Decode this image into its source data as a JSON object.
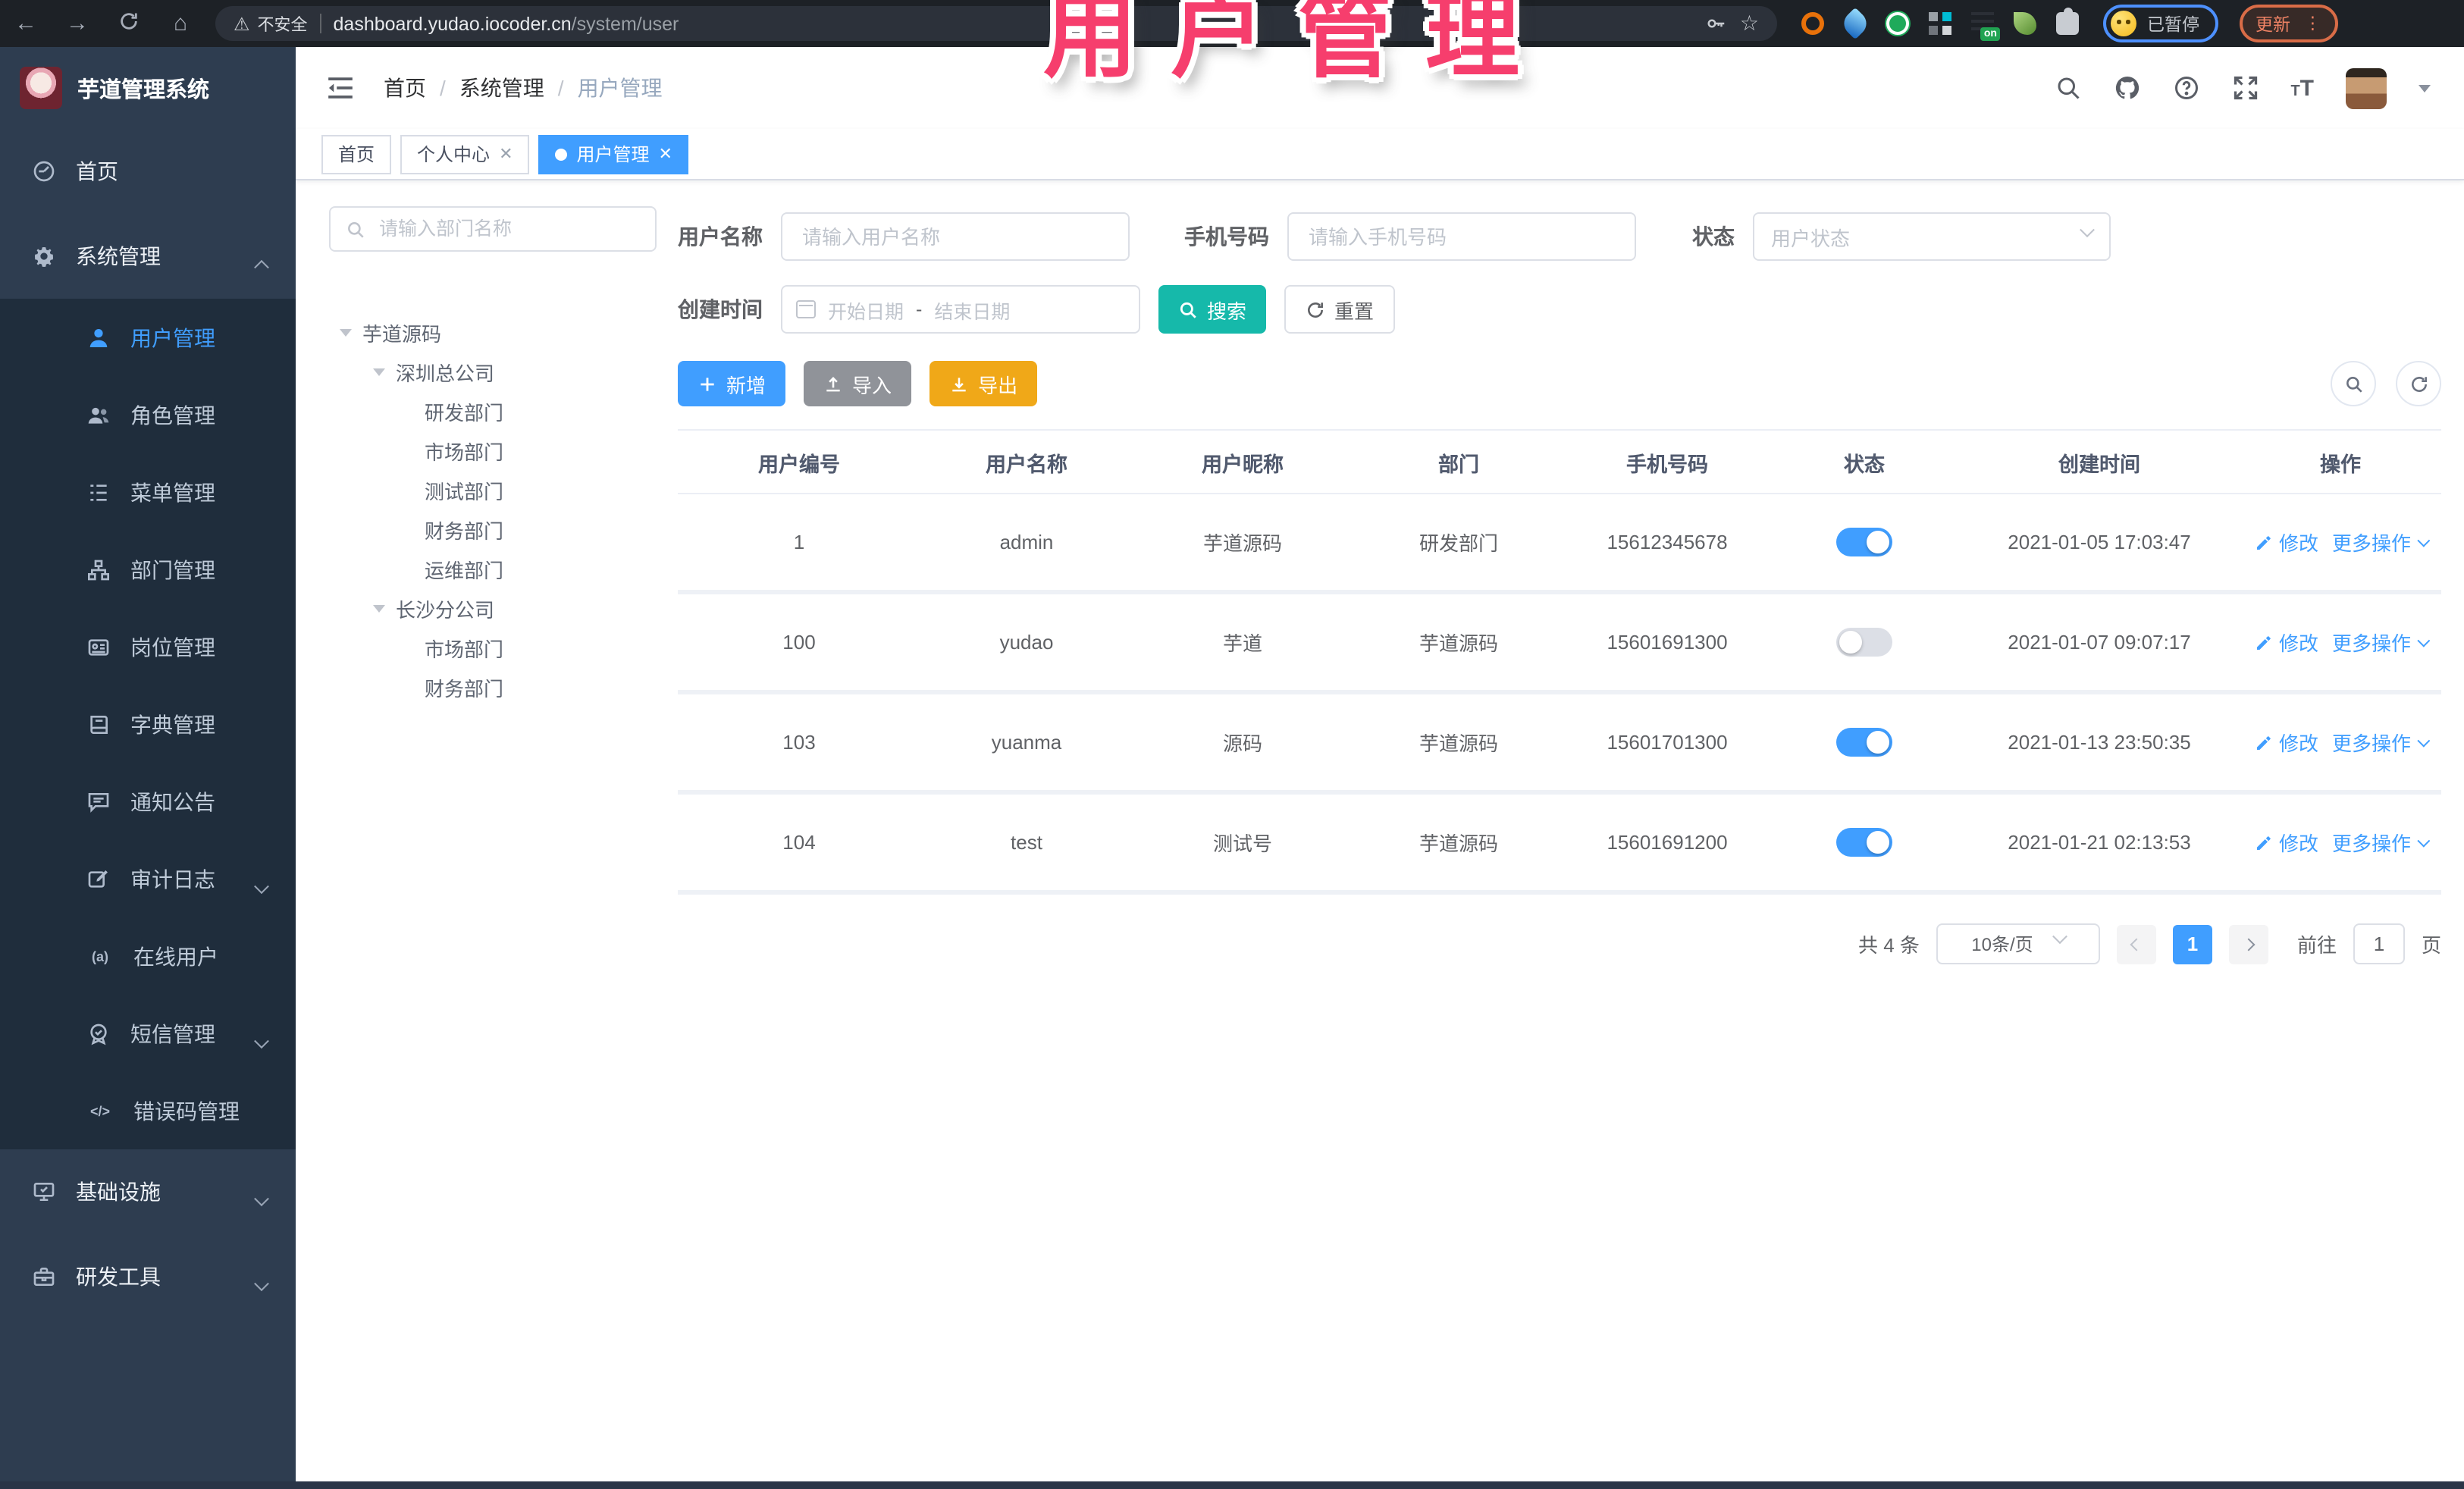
{
  "overlay_title": "用户管理",
  "browser": {
    "security_label": "不安全",
    "url_domain": "dashboard.yudao.iocoder.cn",
    "url_path": "/system/user",
    "extension_on_badge": "on",
    "paused_badge": "已暂停",
    "update_label": "更新"
  },
  "sidebar": {
    "app_title": "芋道管理系统",
    "items": [
      {
        "label": "首页"
      },
      {
        "label": "系统管理"
      },
      {
        "label": "用户管理"
      },
      {
        "label": "角色管理"
      },
      {
        "label": "菜单管理"
      },
      {
        "label": "部门管理"
      },
      {
        "label": "岗位管理"
      },
      {
        "label": "字典管理"
      },
      {
        "label": "通知公告"
      },
      {
        "label": "审计日志"
      },
      {
        "label": "在线用户"
      },
      {
        "label": "短信管理"
      },
      {
        "label": "错误码管理"
      },
      {
        "label": "基础设施"
      },
      {
        "label": "研发工具"
      }
    ]
  },
  "breadcrumb": {
    "items": [
      "首页",
      "系统管理",
      "用户管理"
    ],
    "sep": "/"
  },
  "tabs": [
    {
      "label": "首页"
    },
    {
      "label": "个人中心"
    },
    {
      "label": "用户管理"
    }
  ],
  "tree": {
    "search_placeholder": "请输入部门名称",
    "nodes": [
      {
        "label": "芋道源码"
      },
      {
        "label": "深圳总公司"
      },
      {
        "label": "研发部门"
      },
      {
        "label": "市场部门"
      },
      {
        "label": "测试部门"
      },
      {
        "label": "财务部门"
      },
      {
        "label": "运维部门"
      },
      {
        "label": "长沙分公司"
      },
      {
        "label": "市场部门"
      },
      {
        "label": "财务部门"
      }
    ]
  },
  "filters": {
    "username_label": "用户名称",
    "username_placeholder": "请输入用户名称",
    "mobile_label": "手机号码",
    "mobile_placeholder": "请输入手机号码",
    "status_label": "状态",
    "status_placeholder": "用户状态",
    "create_time_label": "创建时间",
    "date_start_placeholder": "开始日期",
    "date_separator": "-",
    "date_end_placeholder": "结束日期",
    "search_label": "搜索",
    "reset_label": "重置"
  },
  "toolbar": {
    "add_label": "新增",
    "import_label": "导入",
    "export_label": "导出"
  },
  "table": {
    "columns": [
      "用户编号",
      "用户名称",
      "用户昵称",
      "部门",
      "手机号码",
      "状态",
      "创建时间",
      "操作"
    ],
    "action_edit": "修改",
    "action_more": "更多操作",
    "rows": [
      {
        "id": "1",
        "username": "admin",
        "nickname": "芋道源码",
        "dept": "研发部门",
        "mobile": "15612345678",
        "status_on": true,
        "created": "2021-01-05 17:03:47"
      },
      {
        "id": "100",
        "username": "yudao",
        "nickname": "芋道",
        "dept": "芋道源码",
        "mobile": "15601691300",
        "status_on": false,
        "created": "2021-01-07 09:07:17"
      },
      {
        "id": "103",
        "username": "yuanma",
        "nickname": "源码",
        "dept": "芋道源码",
        "mobile": "15601701300",
        "status_on": true,
        "created": "2021-01-13 23:50:35"
      },
      {
        "id": "104",
        "username": "test",
        "nickname": "测试号",
        "dept": "芋道源码",
        "mobile": "15601691200",
        "status_on": true,
        "created": "2021-01-21 02:13:53"
      }
    ]
  },
  "pagination": {
    "total": "共 4 条",
    "page_size": "10条/页",
    "current_page": "1",
    "goto_label": "前往",
    "goto_value": "1",
    "page_unit": "页"
  },
  "colors": {
    "accent_blue": "#409eff",
    "sidebar_bg": "#2e3d50",
    "submenu_bg": "#1f2d3c",
    "search_teal": "#16b9aa",
    "export_amber": "#f0a818",
    "overlay_pink": "#f63e6d"
  }
}
